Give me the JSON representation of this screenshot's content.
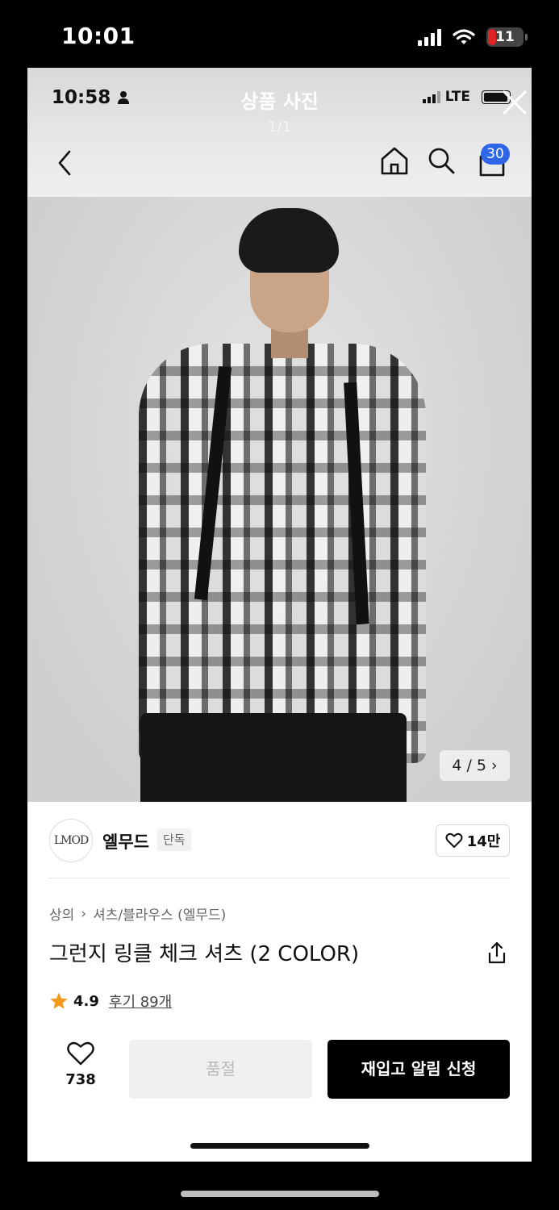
{
  "outer_status": {
    "time": "10:01",
    "battery": "11"
  },
  "inner_status": {
    "time": "10:58",
    "network": "LTE"
  },
  "viewer": {
    "title": "상품 사진",
    "page": "1/1"
  },
  "nav": {
    "cart_count": "30"
  },
  "image_counter": "4 / 5",
  "brand": {
    "logo_text": "LMOD",
    "name": "엘무드",
    "tag": "단독",
    "likes": "14만"
  },
  "breadcrumb": [
    "상의",
    "셔츠/블라우스 (엘무드)"
  ],
  "product": {
    "title": "그런지 링클 체크 셔츠 (2 COLOR)",
    "rating": "4.9",
    "reviews": "후기 89개"
  },
  "actions": {
    "wish_count": "738",
    "soldout_label": "품절",
    "restock_label": "재입고 알림 신청"
  },
  "colors": {
    "badge_blue": "#2f66e8",
    "star_orange": "#f29a1d",
    "battery_red": "#e02424"
  }
}
